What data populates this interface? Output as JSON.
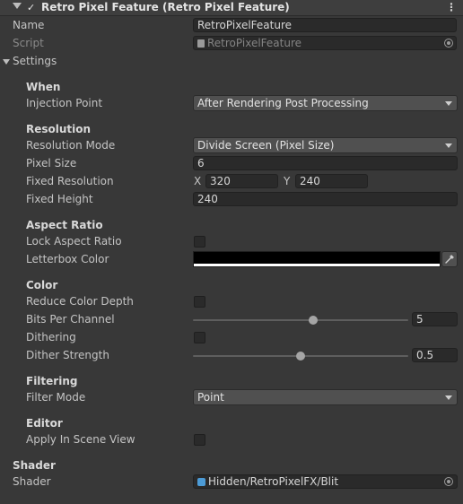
{
  "header": {
    "title": "Retro Pixel Feature (Retro Pixel Feature)"
  },
  "name": {
    "label": "Name",
    "value": "RetroPixelFeature"
  },
  "script": {
    "label": "Script",
    "value": "RetroPixelFeature"
  },
  "settings": {
    "label": "Settings"
  },
  "when": {
    "heading": "When",
    "injection_point": {
      "label": "Injection Point",
      "value": "After Rendering Post Processing"
    }
  },
  "resolution": {
    "heading": "Resolution",
    "mode": {
      "label": "Resolution Mode",
      "value": "Divide Screen (Pixel Size)"
    },
    "pixel_size": {
      "label": "Pixel Size",
      "value": "6"
    },
    "fixed_resolution": {
      "label": "Fixed Resolution",
      "x_label": "X",
      "x": "320",
      "y_label": "Y",
      "y": "240"
    },
    "fixed_height": {
      "label": "Fixed Height",
      "value": "240"
    }
  },
  "aspect": {
    "heading": "Aspect Ratio",
    "lock": {
      "label": "Lock Aspect Ratio",
      "checked": false
    },
    "letterbox": {
      "label": "Letterbox Color",
      "color": "#000000"
    }
  },
  "color": {
    "heading": "Color",
    "reduce_depth": {
      "label": "Reduce Color Depth",
      "checked": false
    },
    "bits_per_channel": {
      "label": "Bits Per Channel",
      "value": "5",
      "fraction": 0.56
    },
    "dithering": {
      "label": "Dithering",
      "checked": false
    },
    "dither_strength": {
      "label": "Dither Strength",
      "value": "0.5",
      "fraction": 0.5
    }
  },
  "filtering": {
    "heading": "Filtering",
    "filter_mode": {
      "label": "Filter Mode",
      "value": "Point"
    }
  },
  "editor": {
    "heading": "Editor",
    "apply_scene": {
      "label": "Apply In Scene View",
      "checked": false
    }
  },
  "shader_section": {
    "heading": "Shader",
    "shader": {
      "label": "Shader",
      "value": "Hidden/RetroPixelFX/Blit"
    }
  }
}
